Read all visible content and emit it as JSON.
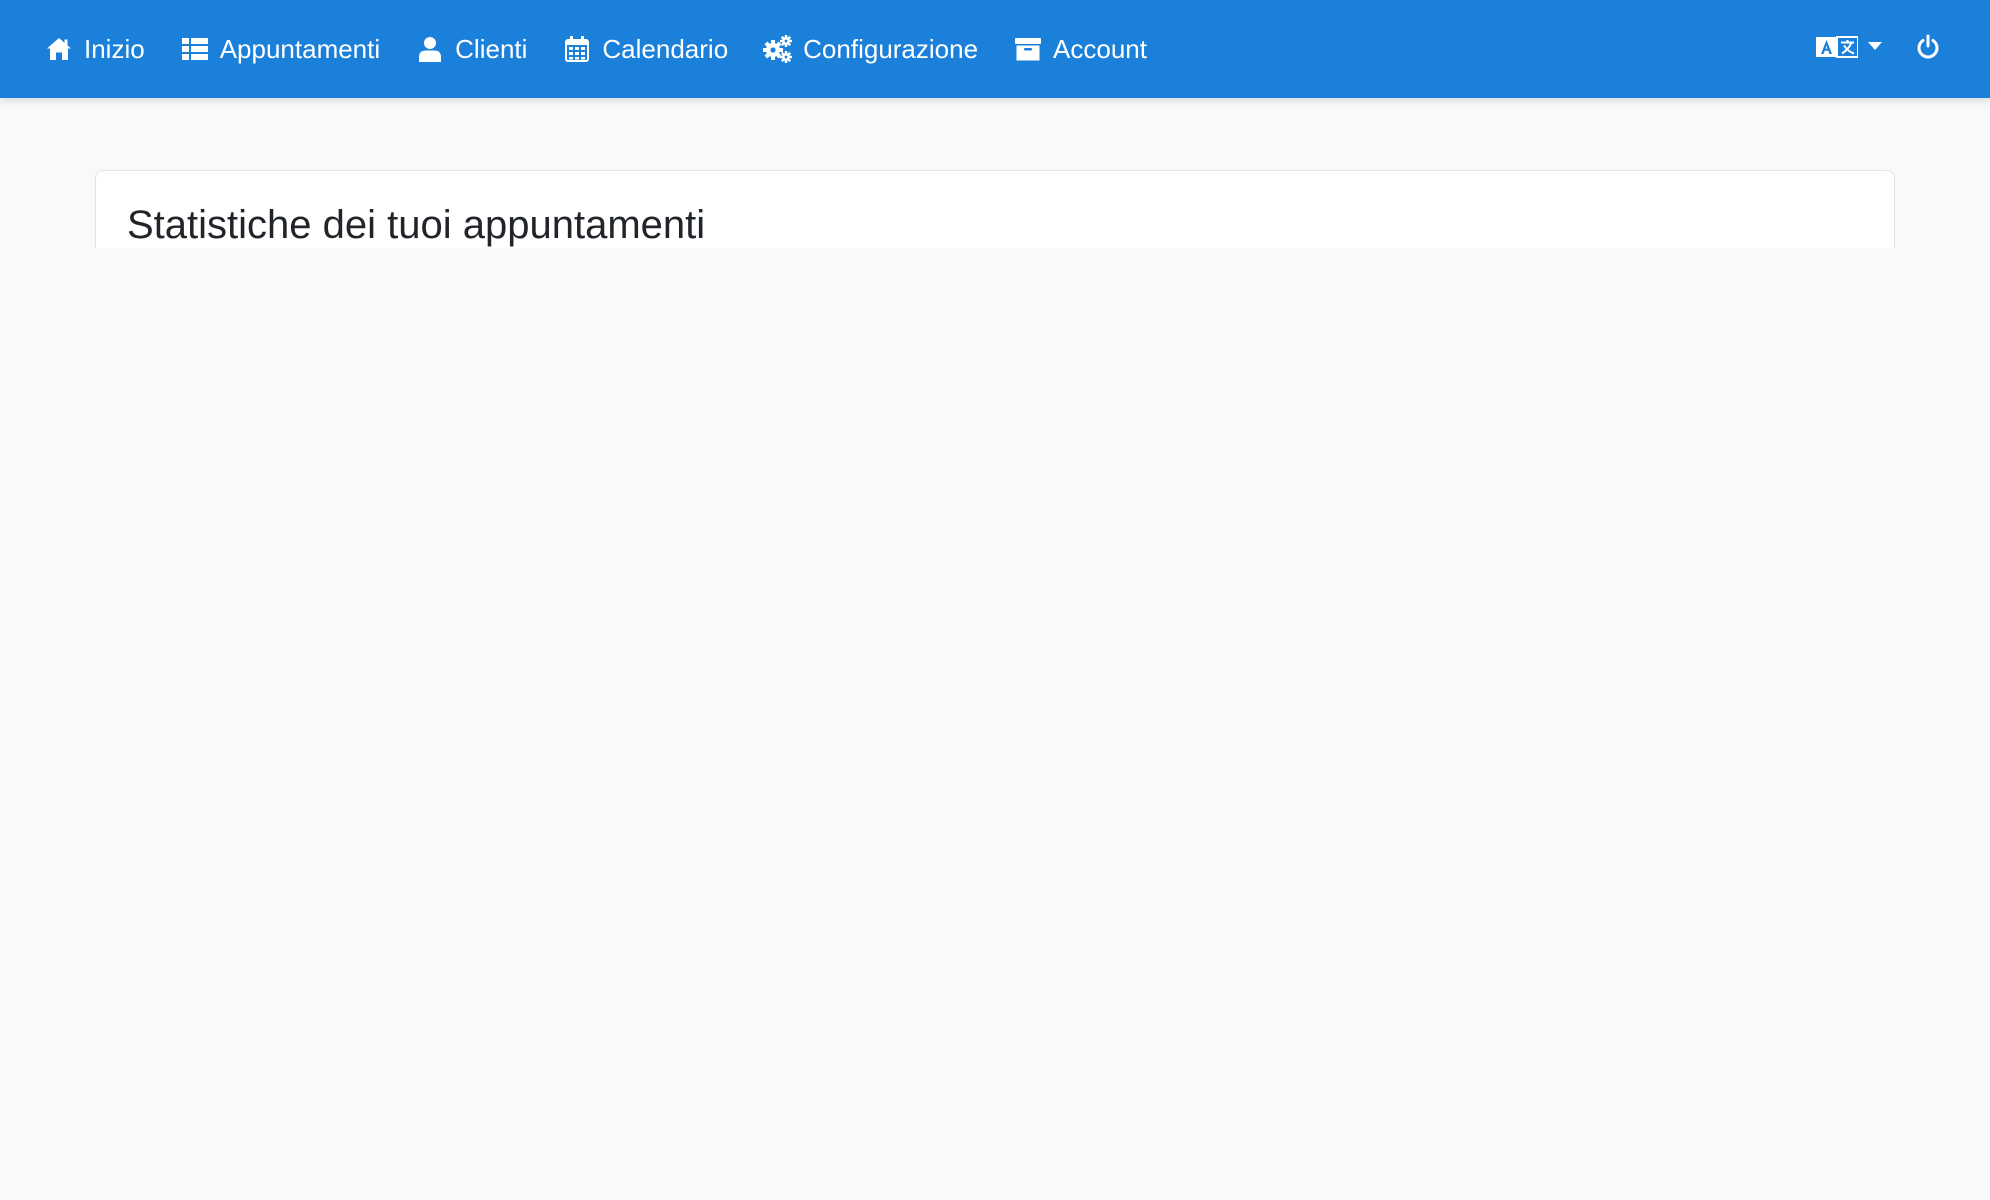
{
  "nav": {
    "items": [
      {
        "label": "Inizio",
        "icon": "home-icon"
      },
      {
        "label": "Appuntamenti",
        "icon": "list-icon"
      },
      {
        "label": "Clienti",
        "icon": "user-icon"
      },
      {
        "label": "Calendario",
        "icon": "calendar-icon"
      },
      {
        "label": "Configurazione",
        "icon": "cogs-icon"
      },
      {
        "label": "Account",
        "icon": "archive-icon"
      }
    ],
    "right": {
      "language_icon": "language-icon",
      "power_icon": "power-icon"
    }
  },
  "main": {
    "card_title": "Statistiche dei tuoi appuntamenti"
  },
  "colors": {
    "navbar": "#1b80da",
    "background": "#f7f9fb",
    "card": "#ffffff",
    "title": "#212529"
  }
}
